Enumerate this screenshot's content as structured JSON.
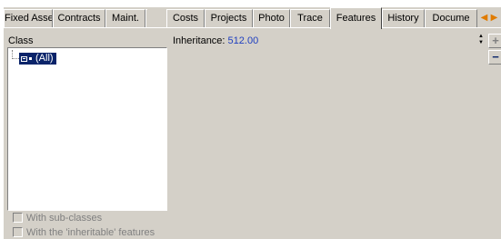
{
  "tabs": [
    {
      "label": "Fixed Asset"
    },
    {
      "label": "Contracts"
    },
    {
      "label": "Maint."
    },
    {
      "label": "Costs"
    },
    {
      "label": "Projects"
    },
    {
      "label": "Photo"
    },
    {
      "label": "Trace"
    },
    {
      "label": "Features"
    },
    {
      "label": "History"
    },
    {
      "label": "Docume"
    }
  ],
  "active_tab": "Features",
  "tab_scroll": {
    "left_icon": "◀",
    "right_icon": "▶",
    "icon_names": [
      "arrow-left-icon",
      "arrow-right-icon"
    ],
    "color": "#e07b00"
  },
  "class_panel": {
    "header": "Class",
    "tree_node": "(All)",
    "selected_color": "#0a246a"
  },
  "options": {
    "with_subclasses": "With sub-classes",
    "with_inheritable": "With the 'inheritable' features"
  },
  "inheritance": {
    "label": "Inheritance:",
    "value": "512.00",
    "value_color": "#2040c0"
  },
  "side_buttons": {
    "add": "+",
    "remove": "−"
  }
}
